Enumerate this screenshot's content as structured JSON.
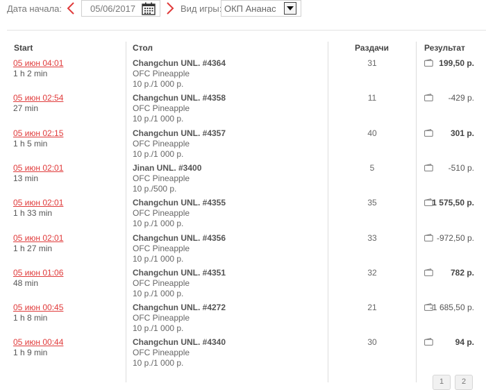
{
  "filters": {
    "date_label": "Дата начала:",
    "date_value": "05/06/2017",
    "game_label": "Вид игры:",
    "game_value": "ОКП Ананас"
  },
  "columns": {
    "start": "Start",
    "table": "Стол",
    "hands": "Раздачи",
    "result": "Результат"
  },
  "rows": [
    {
      "start": "05 июн 04:01",
      "duration": "1 h 2 min",
      "table": "Changchun UNL. #4364",
      "game": "OFC Pineapple",
      "stakes": "10 р./1 000 р.",
      "hands": "31",
      "result": "199,50 р.",
      "positive": true
    },
    {
      "start": "05 июн 02:54",
      "duration": "27 min",
      "table": "Changchun UNL. #4358",
      "game": "OFC Pineapple",
      "stakes": "10 р./1 000 р.",
      "hands": "11",
      "result": "-429 р.",
      "positive": false
    },
    {
      "start": "05 июн 02:15",
      "duration": "1 h 5 min",
      "table": "Changchun UNL. #4357",
      "game": "OFC Pineapple",
      "stakes": "10 р./1 000 р.",
      "hands": "40",
      "result": "301 р.",
      "positive": true
    },
    {
      "start": "05 июн 02:01",
      "duration": "13 min",
      "table": "Jinan UNL. #3400",
      "game": "OFC Pineapple",
      "stakes": "10 р./500 р.",
      "hands": "5",
      "result": "-510 р.",
      "positive": false
    },
    {
      "start": "05 июн 02:01",
      "duration": "1 h 33 min",
      "table": "Changchun UNL. #4355",
      "game": "OFC Pineapple",
      "stakes": "10 р./1 000 р.",
      "hands": "35",
      "result": "1 575,50 р.",
      "positive": true
    },
    {
      "start": "05 июн 02:01",
      "duration": "1 h 27 min",
      "table": "Changchun UNL. #4356",
      "game": "OFC Pineapple",
      "stakes": "10 р./1 000 р.",
      "hands": "33",
      "result": "-972,50 р.",
      "positive": false
    },
    {
      "start": "05 июн 01:06",
      "duration": "48 min",
      "table": "Changchun UNL. #4351",
      "game": "OFC Pineapple",
      "stakes": "10 р./1 000 р.",
      "hands": "32",
      "result": "782 р.",
      "positive": true
    },
    {
      "start": "05 июн 00:45",
      "duration": "1 h 8 min",
      "table": "Changchun UNL. #4272",
      "game": "OFC Pineapple",
      "stakes": "10 р./1 000 р.",
      "hands": "21",
      "result": "-1 685,50 р.",
      "positive": false
    },
    {
      "start": "05 июн 00:44",
      "duration": "1 h 9 min",
      "table": "Changchun UNL. #4340",
      "game": "OFC Pineapple",
      "stakes": "10 р./1 000 р.",
      "hands": "30",
      "result": "94 р.",
      "positive": true
    }
  ],
  "pagination": {
    "page1": "1",
    "page2": "2"
  },
  "colors": {
    "accent_red": "#e03a3a",
    "separator": "#dcdcdc"
  }
}
